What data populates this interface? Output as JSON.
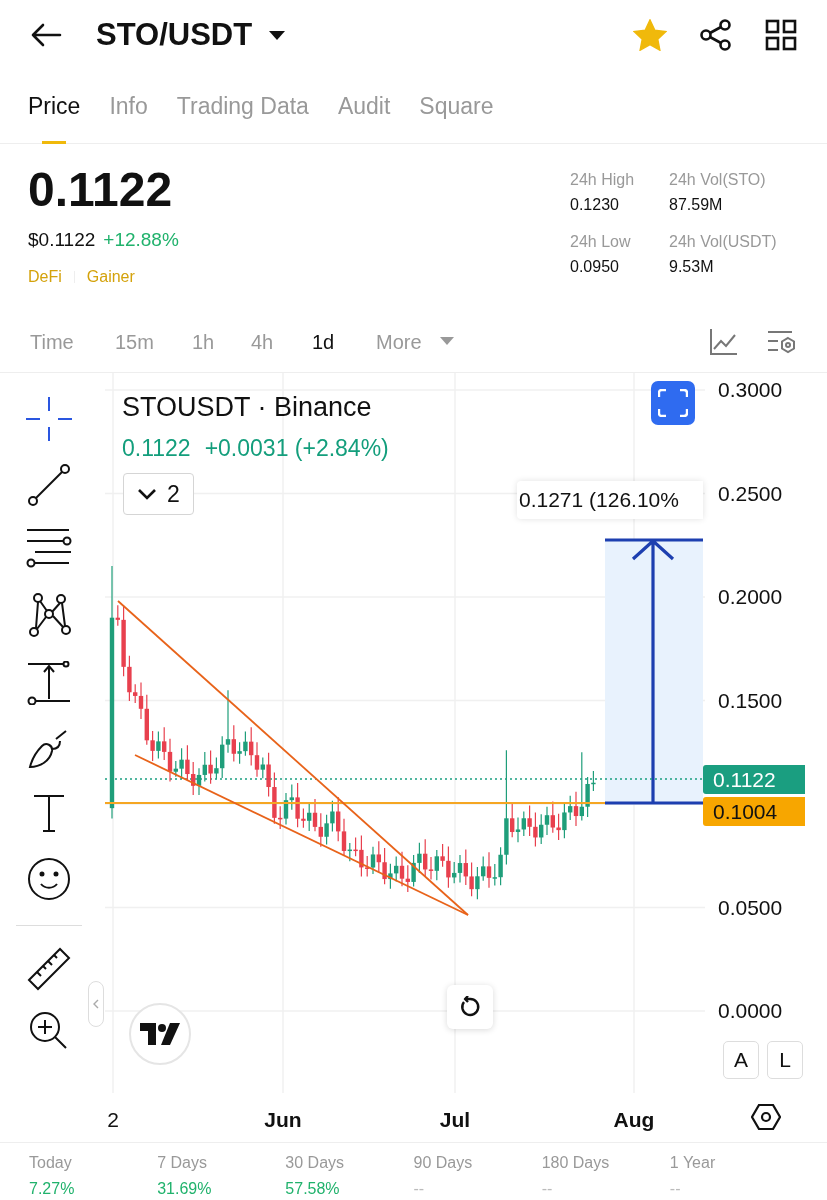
{
  "header": {
    "title": "STO/USDT",
    "starred": true
  },
  "tabs": [
    {
      "label": "Price",
      "selected": true
    },
    {
      "label": "Info",
      "selected": false
    },
    {
      "label": "Trading Data",
      "selected": false
    },
    {
      "label": "Audit",
      "selected": false
    },
    {
      "label": "Square",
      "selected": false
    }
  ],
  "price": {
    "last": "0.1122",
    "usd": "$0.1122",
    "change": "+12.88%",
    "tags": [
      "DeFi",
      "Gainer"
    ]
  },
  "stats": [
    {
      "label": "24h High",
      "value": "0.1230"
    },
    {
      "label": "24h Vol(STO)",
      "value": "87.59M"
    },
    {
      "label": "24h Low",
      "value": "0.0950"
    },
    {
      "label": "24h Vol(USDT)",
      "value": "9.53M"
    }
  ],
  "intervals": [
    {
      "label": "Time",
      "selected": false,
      "kind": "option"
    },
    {
      "label": "15m",
      "selected": false,
      "kind": "option"
    },
    {
      "label": "1h",
      "selected": false,
      "kind": "option"
    },
    {
      "label": "4h",
      "selected": false,
      "kind": "option"
    },
    {
      "label": "1d",
      "selected": true,
      "kind": "option"
    },
    {
      "label": "More",
      "selected": false,
      "kind": "dropdown"
    }
  ],
  "chart": {
    "title": "STOUSDT · Binance",
    "last": "0.1122",
    "change": "+0.0031 (+2.84%)",
    "indicators": "2",
    "measure_label": "0.1271 (126.10%",
    "price_axis": [
      "0.3000",
      "0.2500",
      "0.2000",
      "0.1500",
      "0.0500",
      "0.0000"
    ],
    "badges": [
      {
        "text": "0.1122",
        "color": "#1a9e80"
      },
      {
        "text": "0.1004",
        "color": "#f7a600"
      }
    ],
    "date_axis": [
      {
        "label": "2",
        "kind": "day"
      },
      {
        "label": "Jun",
        "kind": "month"
      },
      {
        "label": "Jul",
        "kind": "month"
      },
      {
        "label": "Aug",
        "kind": "month"
      }
    ],
    "scale_buttons": [
      "A",
      "L"
    ]
  },
  "period_changes": [
    {
      "label": "Today",
      "value": "7.27%",
      "positive": true
    },
    {
      "label": "7 Days",
      "value": "31.69%",
      "positive": true
    },
    {
      "label": "30 Days",
      "value": "57.58%",
      "positive": true
    },
    {
      "label": "90 Days",
      "value": "--",
      "positive": false
    },
    {
      "label": "180 Days",
      "value": "--",
      "positive": false
    },
    {
      "label": "1 Year",
      "value": "--",
      "positive": false
    }
  ]
}
